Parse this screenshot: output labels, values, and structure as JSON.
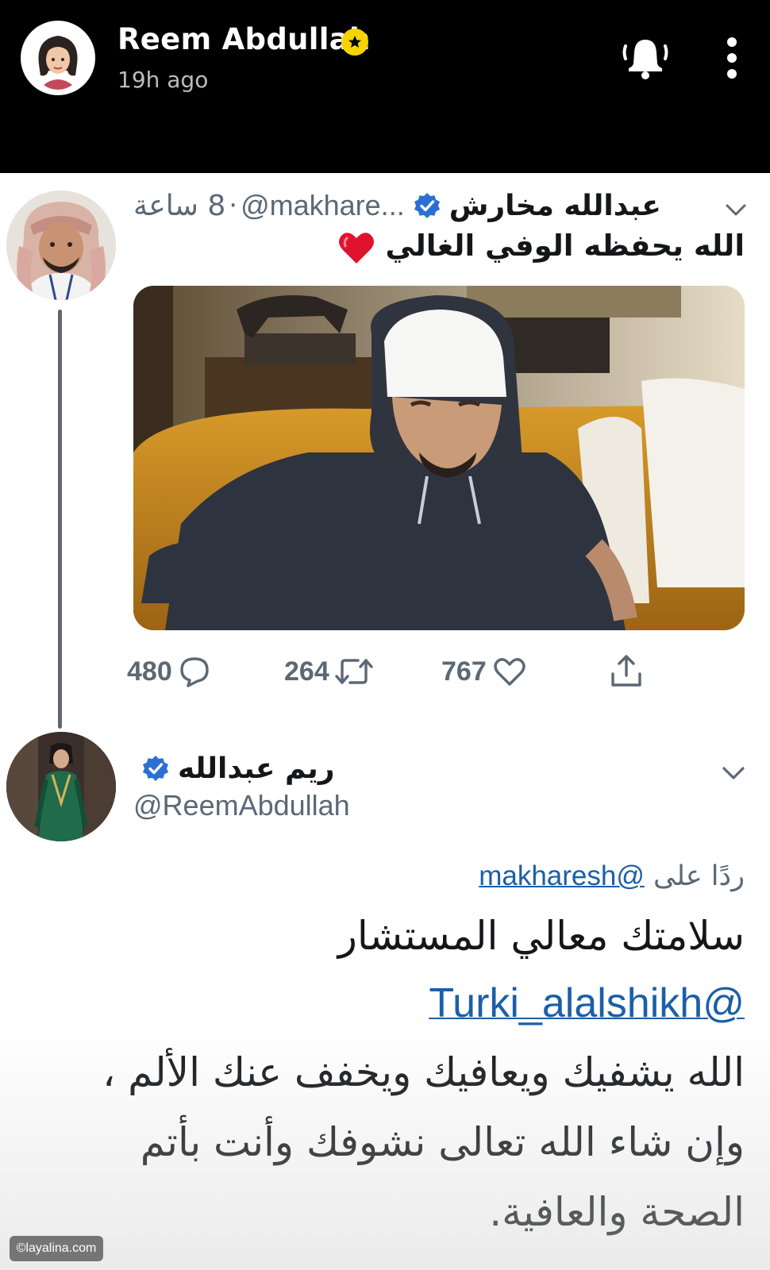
{
  "story_header": {
    "name": "Reem Abdullah",
    "time": "19h ago",
    "badge_color": "#f7d300",
    "icons": [
      "bitmoji-avatar",
      "bell-icon",
      "more-vertical-icon"
    ]
  },
  "tweet": {
    "author_name": "عبدالله مخارش",
    "handle": "@makhare...",
    "separator": "·",
    "time": "8 ساعة",
    "text": "الله يحفظه الوفي الغالي",
    "stats": {
      "replies": "480",
      "retweets": "264",
      "likes": "767"
    }
  },
  "reply": {
    "author_name": "ريم عبدالله",
    "handle": "@ReemAbdullah",
    "replying_prefix": "ردًا على",
    "replying_to": "@makharesh",
    "line1": "سلامتك معالي المستشار",
    "mention": "@Turki_alalshikh",
    "line3": "الله يشفيك ويعافيك ويخفف عنك الألم ،",
    "line4": "وإن شاء الله تعالى نشوفك وأنت بأتم",
    "line5": "الصحة والعافية."
  },
  "colors": {
    "verified": "#2a6fd4",
    "link": "#1b5fa8",
    "heart": "#e0245e"
  },
  "watermark": "©layalina.com"
}
